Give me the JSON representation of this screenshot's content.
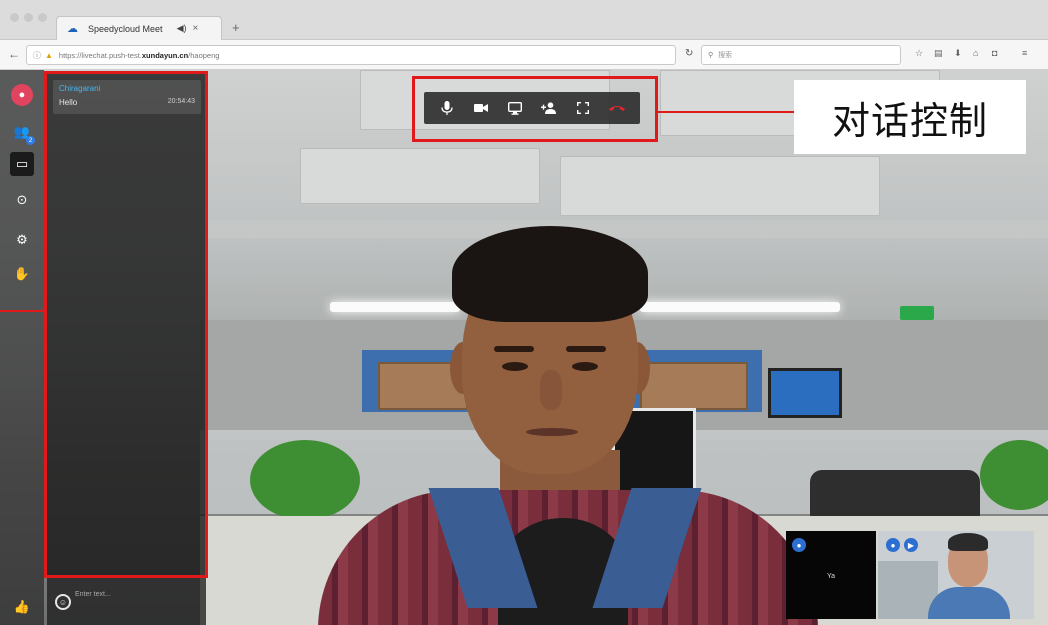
{
  "browser": {
    "tab_title": "Speedycloud Meet",
    "tab_audio_icon": "speaker-icon",
    "tab_close": "×",
    "new_tab": "+",
    "url_prefix": "https://livechat.push-test.",
    "url_domain": "xundayun.cn",
    "url_path": "/haopeng",
    "search_placeholder": "搜索"
  },
  "toolbar": {
    "items": [
      {
        "name": "avatar",
        "icon": "avatar-icon",
        "active": false
      },
      {
        "name": "contacts",
        "icon": "contacts-icon",
        "badge": "2",
        "active": false
      },
      {
        "name": "chat",
        "icon": "chat-icon",
        "active": true
      },
      {
        "name": "record",
        "icon": "record-icon",
        "active": false
      },
      {
        "name": "settings",
        "icon": "gear-icon",
        "active": false
      },
      {
        "name": "raise-hand",
        "icon": "hand-icon",
        "active": false
      }
    ],
    "bottom": {
      "icon": "thumbs-up-icon"
    }
  },
  "chat": {
    "messages": [
      {
        "sender": "Chiragarani",
        "text": "Hello",
        "time": "20:54:43"
      }
    ],
    "input_placeholder": "Enter text..."
  },
  "call_controls": {
    "buttons": [
      {
        "name": "microphone",
        "icon": "microphone-icon"
      },
      {
        "name": "camera",
        "icon": "camera-icon"
      },
      {
        "name": "screen-share",
        "icon": "screen-share-icon"
      },
      {
        "name": "invite",
        "icon": "add-person-icon"
      },
      {
        "name": "fullscreen",
        "icon": "fullscreen-icon"
      },
      {
        "name": "hangup",
        "icon": "hangup-icon"
      }
    ]
  },
  "annotation": {
    "label": "对话控制"
  },
  "thumbnails": {
    "local_name": "Ya",
    "remote_icons": [
      "mic-icon",
      "video-icon"
    ]
  },
  "colors": {
    "accent": "#e01a1a",
    "chat_name": "#49b5f0",
    "avatar": "#e0445e",
    "hangup": "#e6272e"
  }
}
